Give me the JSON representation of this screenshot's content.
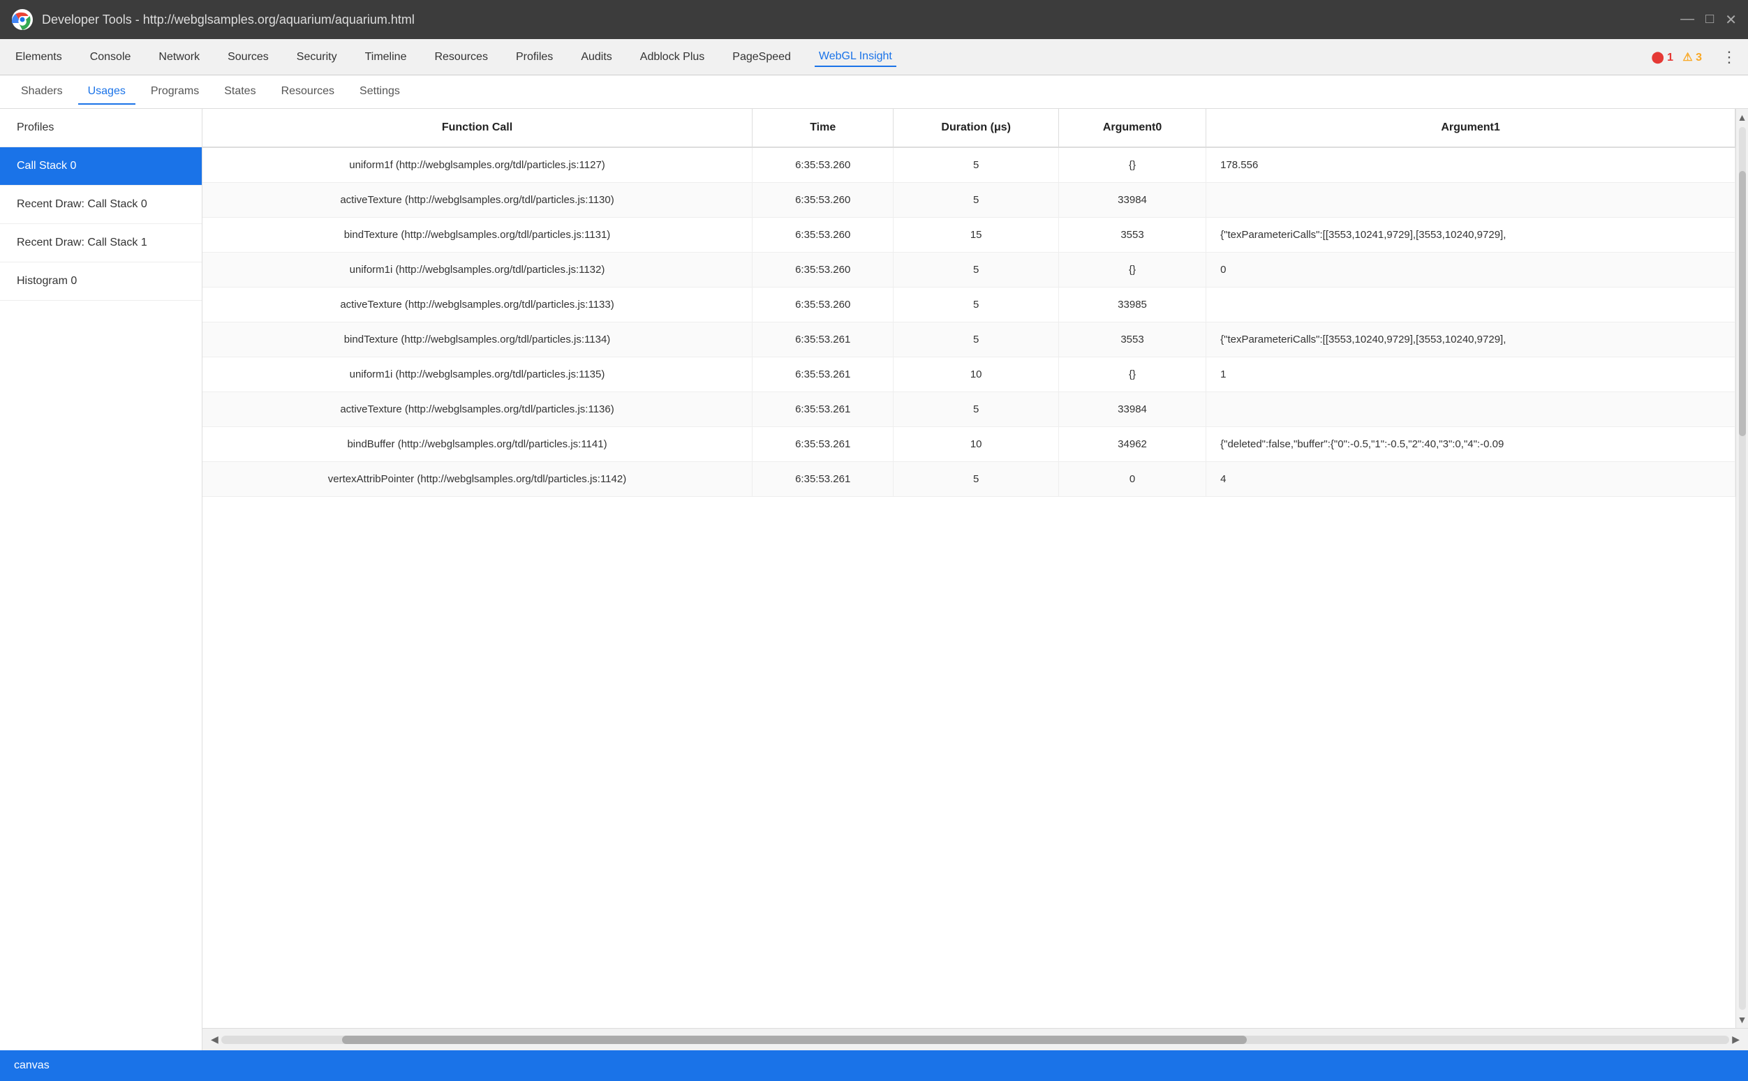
{
  "titlebar": {
    "title": "Developer Tools - http://webglsamples.org/aquarium/aquarium.html",
    "minimize": "—",
    "maximize": "□",
    "close": "✕"
  },
  "menubar": {
    "items": [
      {
        "label": "Elements"
      },
      {
        "label": "Console"
      },
      {
        "label": "Network"
      },
      {
        "label": "Sources"
      },
      {
        "label": "Security"
      },
      {
        "label": "Timeline"
      },
      {
        "label": "Resources"
      },
      {
        "label": "Profiles"
      },
      {
        "label": "Audits"
      },
      {
        "label": "Adblock Plus"
      },
      {
        "label": "PageSpeed"
      },
      {
        "label": "WebGL Insight",
        "active": true
      }
    ],
    "errors": "⓪1  ⚠3",
    "more": "⋮"
  },
  "tabs": [
    {
      "label": "Shaders"
    },
    {
      "label": "Usages",
      "active": true
    },
    {
      "label": "Programs"
    },
    {
      "label": "States"
    },
    {
      "label": "Resources"
    },
    {
      "label": "Settings"
    }
  ],
  "sidebar": {
    "items": [
      {
        "label": "Profiles"
      },
      {
        "label": "Call Stack 0",
        "active": true
      },
      {
        "label": "Recent Draw: Call Stack 0"
      },
      {
        "label": "Recent Draw: Call Stack 1"
      },
      {
        "label": "Histogram 0"
      }
    ]
  },
  "table": {
    "columns": [
      "Function Call",
      "Time",
      "Duration (μs)",
      "Argument0",
      "Argument1"
    ],
    "rows": [
      {
        "function_call": "uniform1f (http://webglsamples.org/tdl/particles.js:1127)",
        "time": "6:35:53.260",
        "duration": "5",
        "arg0": "{}",
        "arg1": "178.556"
      },
      {
        "function_call": "activeTexture (http://webglsamples.org/tdl/particles.js:1130)",
        "time": "6:35:53.260",
        "duration": "5",
        "arg0": "33984",
        "arg1": ""
      },
      {
        "function_call": "bindTexture (http://webglsamples.org/tdl/particles.js:1131)",
        "time": "6:35:53.260",
        "duration": "15",
        "arg0": "3553",
        "arg1": "{\"texParameteriCalls\":[[3553,10241,9729],[3553,10240,9729],"
      },
      {
        "function_call": "uniform1i (http://webglsamples.org/tdl/particles.js:1132)",
        "time": "6:35:53.260",
        "duration": "5",
        "arg0": "{}",
        "arg1": "0"
      },
      {
        "function_call": "activeTexture (http://webglsamples.org/tdl/particles.js:1133)",
        "time": "6:35:53.260",
        "duration": "5",
        "arg0": "33985",
        "arg1": ""
      },
      {
        "function_call": "bindTexture (http://webglsamples.org/tdl/particles.js:1134)",
        "time": "6:35:53.261",
        "duration": "5",
        "arg0": "3553",
        "arg1": "{\"texParameteriCalls\":[[3553,10240,9729],[3553,10240,9729],"
      },
      {
        "function_call": "uniform1i (http://webglsamples.org/tdl/particles.js:1135)",
        "time": "6:35:53.261",
        "duration": "10",
        "arg0": "{}",
        "arg1": "1"
      },
      {
        "function_call": "activeTexture (http://webglsamples.org/tdl/particles.js:1136)",
        "time": "6:35:53.261",
        "duration": "5",
        "arg0": "33984",
        "arg1": ""
      },
      {
        "function_call": "bindBuffer (http://webglsamples.org/tdl/particles.js:1141)",
        "time": "6:35:53.261",
        "duration": "10",
        "arg0": "34962",
        "arg1": "{\"deleted\":false,\"buffer\":{\"0\":-0.5,\"1\":-0.5,\"2\":40,\"3\":0,\"4\":-0.09"
      },
      {
        "function_call": "vertexAttribPointer (http://webglsamples.org/tdl/particles.js:1142)",
        "time": "6:35:53.261",
        "duration": "5",
        "arg0": "0",
        "arg1": "4"
      }
    ]
  },
  "bottom": {
    "canvas_label": "canvas"
  }
}
